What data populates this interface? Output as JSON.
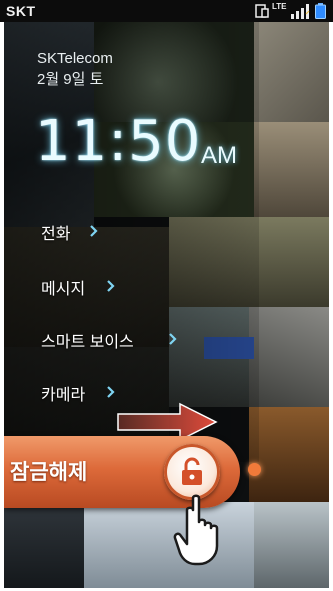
{
  "status_bar": {
    "carrier": "SKT",
    "network_label": "LTE",
    "icons": [
      "screen-icon",
      "lte-icon",
      "signal-icon",
      "battery-icon"
    ]
  },
  "lockscreen": {
    "operator": "SKTelecom",
    "date": "2월 9일 토",
    "time": "11:50",
    "ampm": "AM",
    "shortcuts": [
      {
        "label": "전화",
        "icon": "chevron-right-icon"
      },
      {
        "label": "메시지",
        "icon": "chevron-right-icon"
      },
      {
        "label": "스마트 보이스",
        "icon": "chevron-right-icon"
      },
      {
        "label": "카메라",
        "icon": "chevron-right-icon"
      }
    ],
    "unlock": {
      "label": "잠금해제",
      "icon": "unlock-icon"
    },
    "hint_icons": [
      "arrow-right-icon",
      "hand-pointer-icon"
    ]
  },
  "colors": {
    "clock_glow": "#78dcff",
    "unlock_bar": "#dd6a3a",
    "chevron": "#7fd4f2"
  }
}
